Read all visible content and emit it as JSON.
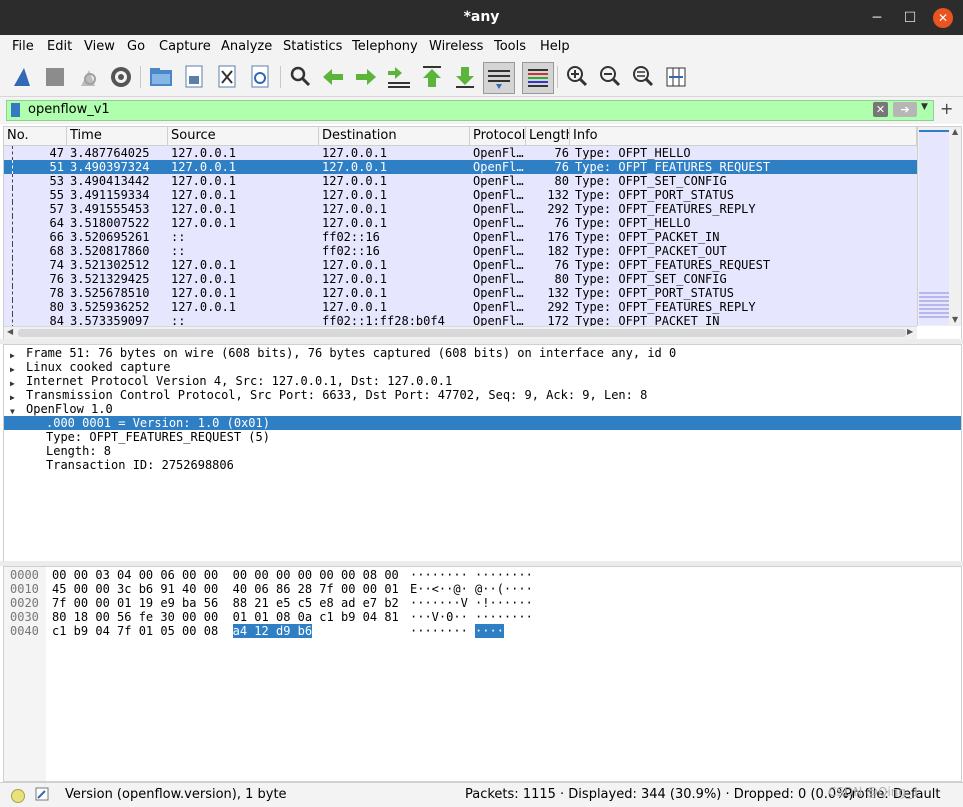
{
  "window": {
    "title": "*any"
  },
  "menu": [
    "File",
    "Edit",
    "View",
    "Go",
    "Capture",
    "Analyze",
    "Statistics",
    "Telephony",
    "Wireless",
    "Tools",
    "Help"
  ],
  "toolbar_icons": [
    "shark-fin-start-icon",
    "stop-icon",
    "restart-icon",
    "options-gear-icon",
    "open-folder-icon",
    "save-file-icon",
    "close-file-icon",
    "reload-icon",
    "find-magnifier-icon",
    "go-back-arrow-icon",
    "go-forward-arrow-icon",
    "go-to-packet-icon",
    "first-packet-icon",
    "last-packet-icon",
    "autoscroll-icon",
    "colorize-icon",
    "zoom-in-icon",
    "zoom-out-icon",
    "zoom-normal-icon",
    "resize-columns-icon"
  ],
  "filter": {
    "value": "openflow_v1"
  },
  "columns": [
    "No.",
    "Time",
    "Source",
    "Destination",
    "Protocol",
    "Length",
    "Info"
  ],
  "packets": [
    {
      "no": "47",
      "time": "3.487764025",
      "src": "127.0.0.1",
      "dst": "127.0.0.1",
      "proto": "OpenFl…",
      "len": "76",
      "info": "Type: OFPT_HELLO"
    },
    {
      "no": "51",
      "time": "3.490397324",
      "src": "127.0.0.1",
      "dst": "127.0.0.1",
      "proto": "OpenFl…",
      "len": "76",
      "info": "Type: OFPT_FEATURES_REQUEST"
    },
    {
      "no": "53",
      "time": "3.490413442",
      "src": "127.0.0.1",
      "dst": "127.0.0.1",
      "proto": "OpenFl…",
      "len": "80",
      "info": "Type: OFPT_SET_CONFIG"
    },
    {
      "no": "55",
      "time": "3.491159334",
      "src": "127.0.0.1",
      "dst": "127.0.0.1",
      "proto": "OpenFl…",
      "len": "132",
      "info": "Type: OFPT_PORT_STATUS"
    },
    {
      "no": "57",
      "time": "3.491555453",
      "src": "127.0.0.1",
      "dst": "127.0.0.1",
      "proto": "OpenFl…",
      "len": "292",
      "info": "Type: OFPT_FEATURES_REPLY"
    },
    {
      "no": "64",
      "time": "3.518007522",
      "src": "127.0.0.1",
      "dst": "127.0.0.1",
      "proto": "OpenFl…",
      "len": "76",
      "info": "Type: OFPT_HELLO"
    },
    {
      "no": "66",
      "time": "3.520695261",
      "src": "::",
      "dst": "ff02::16",
      "proto": "OpenFl…",
      "len": "176",
      "info": "Type: OFPT_PACKET_IN"
    },
    {
      "no": "68",
      "time": "3.520817860",
      "src": "::",
      "dst": "ff02::16",
      "proto": "OpenFl…",
      "len": "182",
      "info": "Type: OFPT_PACKET_OUT"
    },
    {
      "no": "74",
      "time": "3.521302512",
      "src": "127.0.0.1",
      "dst": "127.0.0.1",
      "proto": "OpenFl…",
      "len": "76",
      "info": "Type: OFPT_FEATURES_REQUEST"
    },
    {
      "no": "76",
      "time": "3.521329425",
      "src": "127.0.0.1",
      "dst": "127.0.0.1",
      "proto": "OpenFl…",
      "len": "80",
      "info": "Type: OFPT_SET_CONFIG"
    },
    {
      "no": "78",
      "time": "3.525678510",
      "src": "127.0.0.1",
      "dst": "127.0.0.1",
      "proto": "OpenFl…",
      "len": "132",
      "info": "Type: OFPT_PORT_STATUS"
    },
    {
      "no": "80",
      "time": "3.525936252",
      "src": "127.0.0.1",
      "dst": "127.0.0.1",
      "proto": "OpenFl…",
      "len": "292",
      "info": "Type: OFPT_FEATURES_REPLY"
    },
    {
      "no": "84",
      "time": "3.573359097",
      "src": "::",
      "dst": "ff02::1:ff28:b0f4",
      "proto": "OpenFl…",
      "len": "172",
      "info": "Type: OFPT_PACKET_IN"
    }
  ],
  "details": [
    {
      "text": "Frame 51: 76 bytes on wire (608 bits), 76 bytes captured (608 bits) on interface any, id 0",
      "expander": "collapsed"
    },
    {
      "text": "Linux cooked capture",
      "expander": "collapsed"
    },
    {
      "text": "Internet Protocol Version 4, Src: 127.0.0.1, Dst: 127.0.0.1",
      "expander": "collapsed"
    },
    {
      "text": "Transmission Control Protocol, Src Port: 6633, Dst Port: 47702, Seq: 9, Ack: 9, Len: 8",
      "expander": "collapsed"
    },
    {
      "text": "OpenFlow 1.0",
      "expander": "expanded"
    },
    {
      "text": ".000 0001 = Version: 1.0 (0x01)",
      "expander": "none"
    },
    {
      "text": "Type: OFPT_FEATURES_REQUEST (5)",
      "expander": "none"
    },
    {
      "text": "Length: 8",
      "expander": "none"
    },
    {
      "text": "Transaction ID: 2752698806",
      "expander": "none"
    }
  ],
  "hex": [
    {
      "offset": "0000",
      "hex": "00 00 03 04 00 06 00 00  00 00 00 00 00 00 08 00",
      "ascii": "········ ········"
    },
    {
      "offset": "0010",
      "hex": "45 00 00 3c b6 91 40 00  40 06 86 28 7f 00 00 01",
      "ascii": "E··<··@· @··(····"
    },
    {
      "offset": "0020",
      "hex": "7f 00 00 01 19 e9 ba 56  88 21 e5 c5 e8 ad e7 b2",
      "ascii": "·······V ·!······"
    },
    {
      "offset": "0030",
      "hex": "80 18 00 56 fe 30 00 00  01 01 08 0a c1 b9 04 81",
      "ascii": "···V·0·· ········"
    },
    {
      "offset": "0040",
      "hex": "c1 b9 04 7f 01 05 00 08  ",
      "hex_hl": "a4 12 d9 b6",
      "ascii": "········ ",
      "ascii_hl": "····"
    }
  ],
  "status": {
    "field": "Version (openflow.version), 1 byte",
    "packets": "Packets: 1115 · Displayed: 344 (30.9%) · Dropped: 0 (0.0%)",
    "profile": "Profile: Default",
    "watermark": "CSDN @Qing_1"
  },
  "colors": {
    "row_bg": "#e7e6ff",
    "selection": "#2f7fc4",
    "filter_bg": "#afffaf"
  }
}
